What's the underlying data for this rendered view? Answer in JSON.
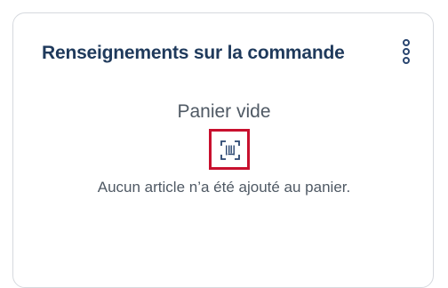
{
  "order_card": {
    "title": "Renseignements sur la commande",
    "menu_icon": "more-vertical-icon",
    "empty_state": {
      "title": "Panier vide",
      "icon": "barcode-scan-icon",
      "highlight_color": "#c8102e",
      "description": "Aucun article n’a été ajouté au panier."
    }
  },
  "colors": {
    "title": "#1f3a5c",
    "text": "#4f5964",
    "border": "#d6d9de"
  }
}
